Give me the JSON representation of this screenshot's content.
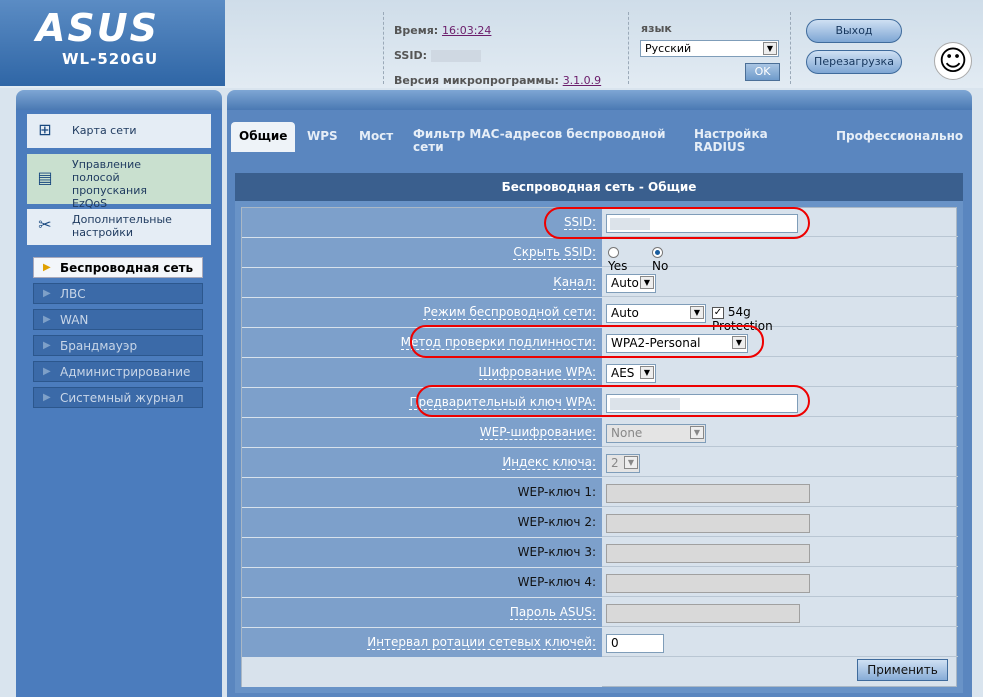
{
  "header": {
    "brand": "ASUS",
    "model": "WL-520GU",
    "time_label": "Время:",
    "time_value": "16:03:24",
    "ssid_label": "SSID:",
    "firmware_label": "Версия микропрограммы:",
    "firmware_value": "3.1.0.9",
    "language_label": "язык",
    "language_value": "Русский",
    "ok_label": "OK",
    "logout_label": "Выход",
    "reboot_label": "Перезагрузка"
  },
  "sidebar": {
    "items": [
      {
        "label": "Карта сети",
        "icon": "network-map-icon"
      },
      {
        "label": "Управление полосой пропускания EzQoS",
        "icon": "ezqos-icon"
      },
      {
        "label": "Дополнительные настройки",
        "icon": "tools-icon"
      }
    ],
    "subitems": [
      {
        "label": "Беспроводная сеть",
        "active": true
      },
      {
        "label": "ЛВС",
        "active": false
      },
      {
        "label": "WAN",
        "active": false
      },
      {
        "label": "Брандмауэр",
        "active": false
      },
      {
        "label": "Администрирование",
        "active": false
      },
      {
        "label": "Системный журнал",
        "active": false
      }
    ]
  },
  "tabs": [
    {
      "label": "Общие",
      "active": true
    },
    {
      "label": "WPS"
    },
    {
      "label": "Мост"
    },
    {
      "label": "Фильтр MAC-адресов беспроводной сети"
    },
    {
      "label": "Настройка RADIUS"
    },
    {
      "label": "Профессионально"
    }
  ],
  "panel": {
    "title": "Беспроводная сеть - Общие",
    "apply_label": "Применить"
  },
  "form": {
    "ssid_label": "SSID:",
    "hide_ssid_label": "Скрыть SSID:",
    "hide_yes": "Yes",
    "hide_no": "No",
    "channel_label": "Канал:",
    "channel_value": "Auto",
    "mode_label": "Режим беспроводной сети:",
    "mode_value": "Auto",
    "protection_label": "54g Protection",
    "auth_label": "Метод проверки подлинности:",
    "auth_value": "WPA2-Personal",
    "wpa_enc_label": "Шифрование WPA:",
    "wpa_enc_value": "AES",
    "psk_label": "Предварительный ключ WPA:",
    "wep_enc_label": "WEP-шифрование:",
    "wep_enc_value": "None",
    "key_index_label": "Индекс ключа:",
    "key_index_value": "2",
    "wep1_label": "WEP-ключ 1:",
    "wep2_label": "WEP-ключ 2:",
    "wep3_label": "WEP-ключ 3:",
    "wep4_label": "WEP-ключ 4:",
    "asus_pass_label": "Пароль ASUS:",
    "rotation_label": "Интервал ротации сетевых ключей:",
    "rotation_value": "0"
  },
  "colors": {
    "highlight": "#e00000",
    "panel_title_bg": "#3a5f8e"
  }
}
